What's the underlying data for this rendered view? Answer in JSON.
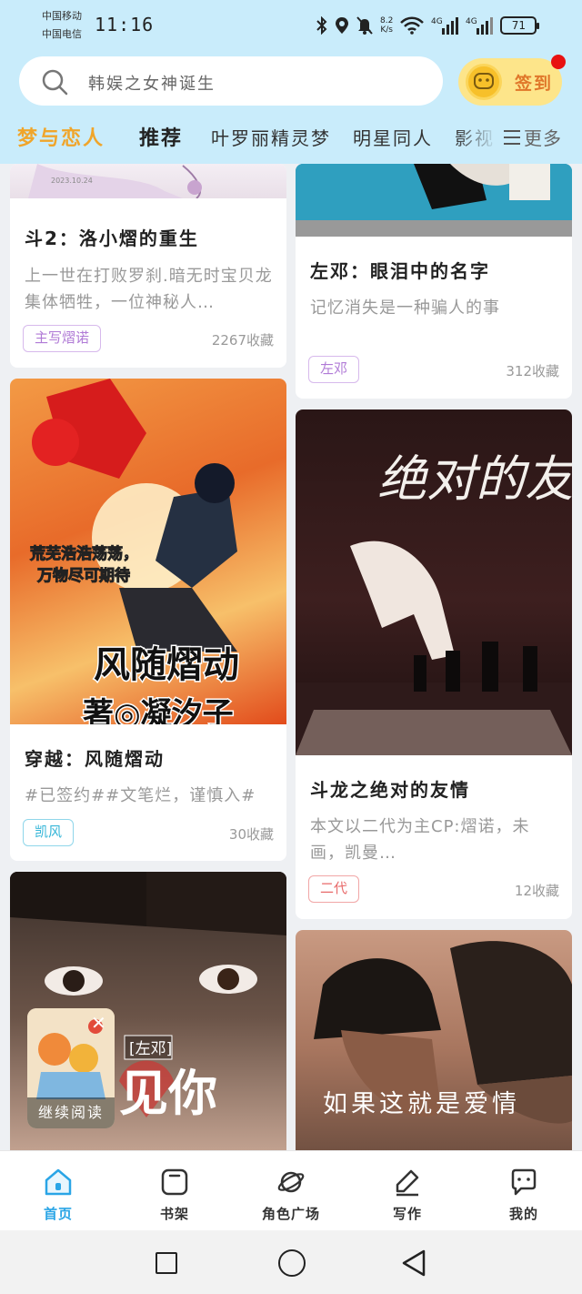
{
  "status_bar": {
    "carrier1": "中国移动",
    "carrier2": "中国电信",
    "time": "11:16",
    "net_speed_top": "8.2",
    "net_speed_bottom": "K/s",
    "signal1_label": "4G",
    "signal2_label": "4G",
    "battery": "71"
  },
  "search": {
    "placeholder": "韩娱之女神诞生"
  },
  "signin": {
    "label": "签到"
  },
  "tabs": [
    {
      "label": "梦与恋人",
      "active": true
    },
    {
      "label": "推荐"
    },
    {
      "label": "叶罗丽精灵梦"
    },
    {
      "label": "明星同人"
    },
    {
      "label": "影视"
    }
  ],
  "more": {
    "label": "更多"
  },
  "cards": [
    {
      "title": "斗2：洛小熠的重生",
      "desc": "上一世在打败罗刹.暗无时宝贝龙集体牺牲，一位神秘人…",
      "tag": "主写熠诺",
      "tag_color": "#b07ad6",
      "favorites": "2267收藏",
      "cover_caption": "2023.10.24"
    },
    {
      "title": "左邓：眼泪中的名字",
      "desc": "记忆消失是一种骗人的事",
      "tag": "左邓",
      "tag_color": "#b07ad6",
      "favorites": "312收藏"
    },
    {
      "title": "穿越：风随熠动",
      "desc": "#已签约##文笔烂，谨慎入#",
      "tag": "凯风",
      "tag_color": "#36b6d8",
      "favorites": "30收藏",
      "cover_text_1": "荒芜浩浩荡荡，",
      "cover_text_2": "万物尽可期待",
      "cover_title": "风随熠动",
      "cover_author": "著◎凝汐子"
    },
    {
      "title": "斗龙之绝对的友情",
      "desc": "本文以二代为主CP:熠诺，未画，凯曼…",
      "tag": "二代",
      "tag_color": "#e86a6a",
      "favorites": "12收藏",
      "cover_title": "绝对的友情"
    },
    {
      "cover_tag": "[左邓]",
      "cover_title": "见你"
    },
    {
      "cover_title": "如果这就是爱情"
    }
  ],
  "continue_reading": {
    "label": "继续阅读"
  },
  "bottom_nav": [
    {
      "label": "首页",
      "icon": "home-icon",
      "active": true
    },
    {
      "label": "书架",
      "icon": "bookshelf-icon"
    },
    {
      "label": "角色广场",
      "icon": "planet-icon"
    },
    {
      "label": "写作",
      "icon": "pen-icon"
    },
    {
      "label": "我的",
      "icon": "chat-bubble-icon"
    }
  ],
  "colors": {
    "header_bg": "#c9ecfb",
    "active_tab": "#f0a52a",
    "active_nav": "#2aa5e6",
    "signin_bg": "#fde58a"
  }
}
